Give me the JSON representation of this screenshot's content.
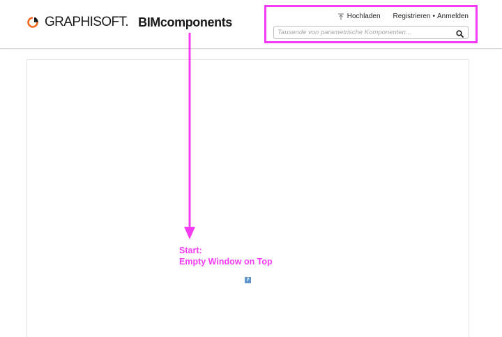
{
  "brand": {
    "name": "GRAPHISOFT.",
    "product": "BIMcomponents"
  },
  "header": {
    "upload_label": "Hochladen",
    "register_label": "Registrieren",
    "separator": "•",
    "login_label": "Anmelden",
    "search": {
      "placeholder": "Tausende von parametrische Komponenten...",
      "value": ""
    }
  },
  "annotation": {
    "line1": "Start:",
    "line2": "Empty Window on Top",
    "color": "#f53cf5"
  },
  "broken_image": {
    "glyph": "?"
  },
  "colors": {
    "logo_orange": "#f26a21",
    "logo_dark": "#1a1a1a",
    "annotation_magenta": "#f53cf5",
    "broken_image_blue": "#5b9ad6"
  },
  "icons": {
    "logo": "graphisoft-logo-icon",
    "upload": "upload-icon",
    "search": "search-icon"
  }
}
